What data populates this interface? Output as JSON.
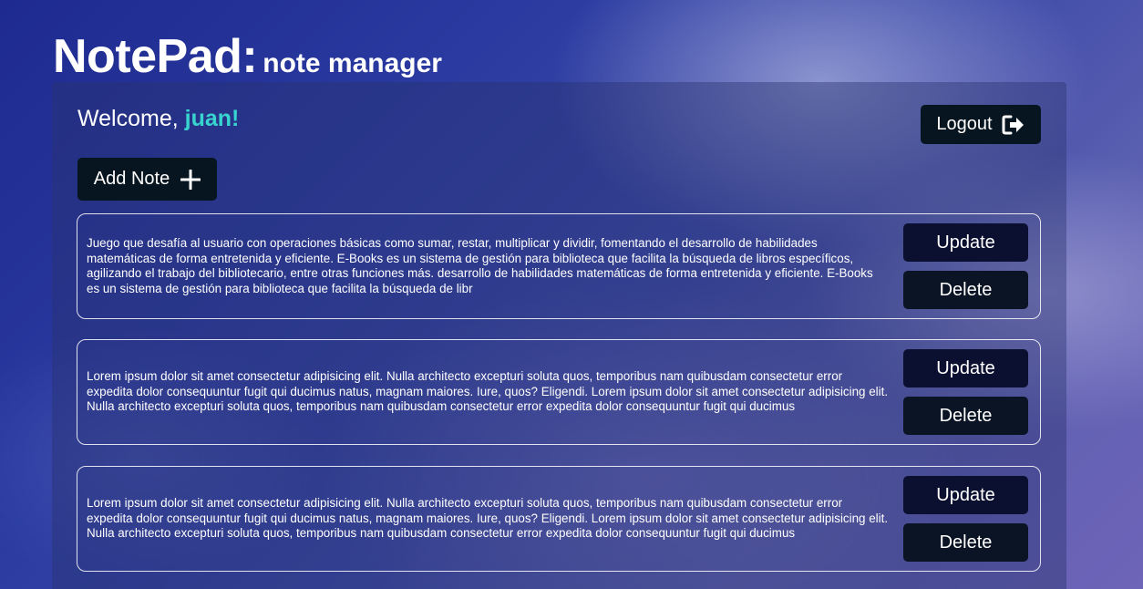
{
  "header": {
    "brand": "NotePad:",
    "subtitle": "note manager"
  },
  "welcome": {
    "greeting": "Welcome,",
    "username": "juan!"
  },
  "actions": {
    "logout_label": "Logout",
    "add_note_label": "Add Note"
  },
  "notes": [
    {
      "text": "Juego que desafía al usuario con operaciones básicas como sumar, restar, multiplicar y dividir, fomentando el desarrollo de habilidades matemáticas de forma entretenida y eficiente. E-Books es un sistema de gestión para biblioteca que facilita la búsqueda de libros específicos, agilizando el trabajo del bibliotecario, entre otras funciones más. desarrollo de habilidades matemáticas de forma entretenida y eficiente. E-Books es un sistema de gestión para biblioteca que facilita la búsqueda de libr",
      "update_label": "Update",
      "delete_label": "Delete"
    },
    {
      "text": "Lorem ipsum dolor sit amet consectetur adipisicing elit. Nulla architecto excepturi soluta quos, temporibus nam quibusdam consectetur error expedita dolor consequuntur fugit qui ducimus natus, magnam maiores. Iure, quos? Eligendi. Lorem ipsum dolor sit amet consectetur adipisicing elit. Nulla architecto excepturi soluta quos, temporibus nam quibusdam consectetur error expedita dolor consequuntur fugit qui ducimus",
      "update_label": "Update",
      "delete_label": "Delete"
    },
    {
      "text": "Lorem ipsum dolor sit amet consectetur adipisicing elit. Nulla architecto excepturi soluta quos, temporibus nam quibusdam consectetur error expedita dolor consequuntur fugit qui ducimus natus, magnam maiores. Iure, quos? Eligendi. Lorem ipsum dolor sit amet consectetur adipisicing elit. Nulla architecto excepturi soluta quos, temporibus nam quibusdam consectetur error expedita dolor consequuntur fugit qui ducimus",
      "update_label": "Update",
      "delete_label": "Delete"
    }
  ],
  "icons": {
    "logout": "logout-icon",
    "add": "plus-icon"
  },
  "colors": {
    "accent": "#38d4cf",
    "button_bg": "#061520"
  }
}
